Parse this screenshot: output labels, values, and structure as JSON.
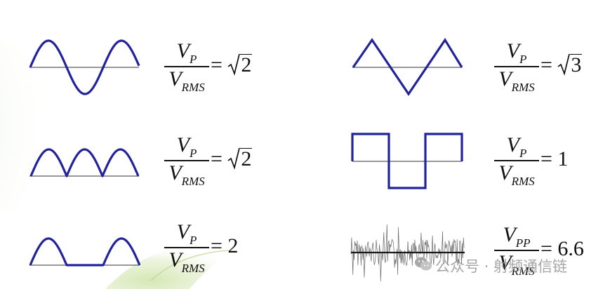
{
  "colors": {
    "wave": "#22239a",
    "baseline": "#777777",
    "noise": "#6a6a6a",
    "noise_axis": "#1a1a1a",
    "text": "#111111",
    "leaf": "#8cb84e",
    "watermark": "#999999"
  },
  "items": [
    {
      "id": "sine",
      "numerator_var": "V",
      "numerator_sub": "P",
      "denominator_var": "V",
      "denominator_sub": "RMS",
      "equals": "=",
      "radical": true,
      "value": "2"
    },
    {
      "id": "triangle",
      "numerator_var": "V",
      "numerator_sub": "P",
      "denominator_var": "V",
      "denominator_sub": "RMS",
      "equals": "=",
      "radical": true,
      "value": "3"
    },
    {
      "id": "full-wave-rectified",
      "numerator_var": "V",
      "numerator_sub": "P",
      "denominator_var": "V",
      "denominator_sub": "RMS",
      "equals": "=",
      "radical": true,
      "value": "2"
    },
    {
      "id": "square",
      "numerator_var": "V",
      "numerator_sub": "P",
      "denominator_var": "V",
      "denominator_sub": "RMS",
      "equals": "=",
      "radical": false,
      "value": "1"
    },
    {
      "id": "half-wave-rectified",
      "numerator_var": "V",
      "numerator_sub": "P",
      "denominator_var": "V",
      "denominator_sub": "RMS",
      "equals": "=",
      "radical": false,
      "value": "2"
    },
    {
      "id": "noise",
      "numerator_var": "V",
      "numerator_sub": "PP",
      "denominator_var": "V",
      "denominator_sub": "RMS",
      "equals": "=",
      "radical": false,
      "value": "6.6"
    }
  ],
  "watermark": {
    "icon": "wechat-icon",
    "text": "公众号 · 射频通信链"
  }
}
